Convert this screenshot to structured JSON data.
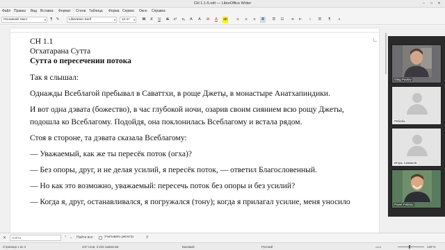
{
  "window": {
    "title": "СН 1.1-5.odt — LibreOffice Writer"
  },
  "menu": [
    "Файл",
    "Правка",
    "Вид",
    "Вставка",
    "Формат",
    "Стили",
    "Таблица",
    "Форма",
    "Сервис",
    "Окно",
    "Справка"
  ],
  "toolbar": {
    "paragraph_style": "Основной текст",
    "font_name": "Liberation Serif",
    "font_size": "12 пт"
  },
  "document": {
    "lines": [
      {
        "text": "СН 1.1",
        "bold": false
      },
      {
        "text": "Огхатарана Сутта",
        "bold": false
      },
      {
        "text": "Сутта о пересечении потока",
        "bold": true
      }
    ],
    "paragraphs": [
      [
        "Так я слышал:"
      ],
      [
        "Однажды Всеблагой пребывал в Саваттхи, в роще Джеты, в монастыре Анатхапиндики."
      ],
      [
        "И вот одна дэвата (божество), в час глубокой ночи, озарив своим сиянием всю рощу Джеты,",
        "подошла ко Всеблагому. Подойдя, она поклонилась Всеблагому и встала рядом."
      ],
      [
        "Стоя в стороне, та дэвата сказала Всеблагому:"
      ],
      [
        "— Уважаемый, как же ты пересёк поток (огха)?"
      ],
      [
        "— Без опоры, друг, и не делая усилий, я пересёк поток, — ответил Благословенный."
      ],
      [
        "— Но как это возможно, уважаемый: пересечь поток без опоры и без усилий?"
      ],
      [
        "— Когда я, друг, останавливался, я погружался (тону); когда я прилагал усилие, меня уносило"
      ]
    ]
  },
  "participants": [
    {
      "name": "Oleg Pavlov",
      "video": true
    },
    {
      "name": "Ребоба",
      "video": false
    },
    {
      "name": "Игорь Симаков",
      "video": false
    },
    {
      "name": "Pavel Fetisov",
      "video": true
    }
  ],
  "findbar": {
    "placeholder": "Найти",
    "find_all": "Найти все",
    "match_case": "Учитывать регистр"
  },
  "status": {
    "page": "Страница 1 из 4",
    "words": "447 слов, 3 218 символов",
    "style": "Базовый",
    "language": "Русский",
    "zoom": "120 %"
  }
}
